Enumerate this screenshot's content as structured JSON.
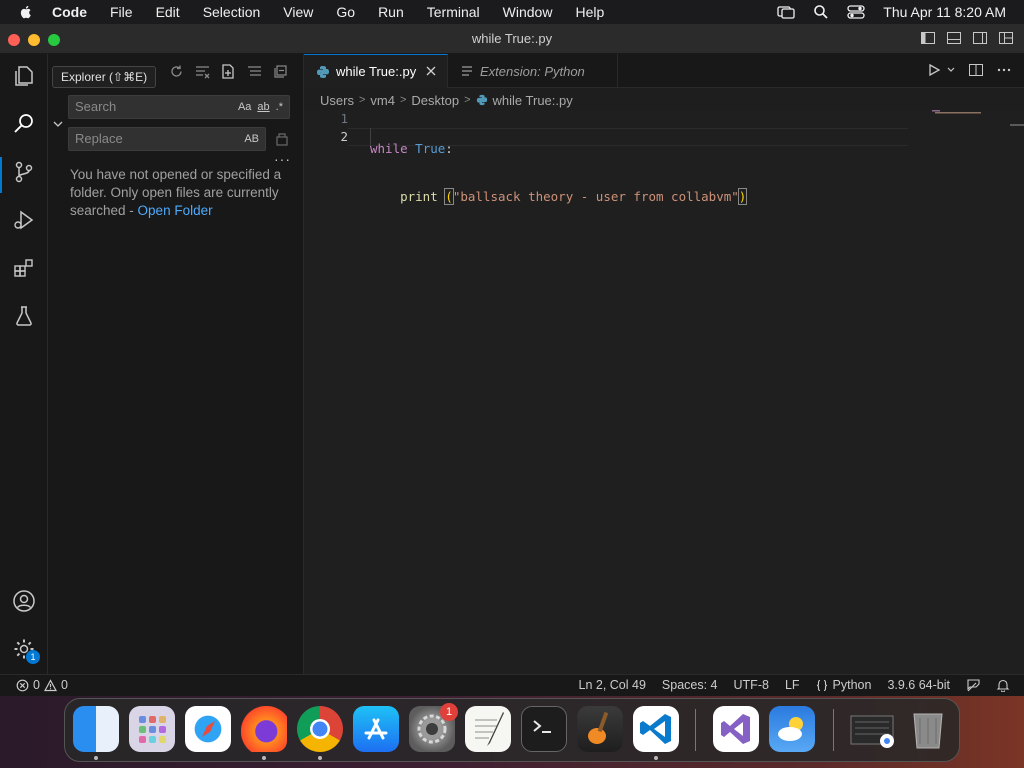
{
  "menubar": {
    "app_name": "Code",
    "items": [
      "File",
      "Edit",
      "Selection",
      "View",
      "Go",
      "Run",
      "Terminal",
      "Window",
      "Help"
    ],
    "clock": "Thu Apr 11  8:20 AM"
  },
  "window": {
    "title": "while True:.py"
  },
  "tooltip": {
    "text": "Explorer (⇧⌘E)"
  },
  "search": {
    "search_placeholder": "Search",
    "replace_placeholder": "Replace",
    "opt_case": "Aa",
    "opt_word": "ab",
    "opt_regex": ".*",
    "opt_preserve_case": "AB",
    "more": "···",
    "info_text": "You have not opened or specified a folder. Only open files are currently searched - ",
    "open_folder_link": "Open Folder"
  },
  "tabs": [
    {
      "label": "while True:.py",
      "active": true
    },
    {
      "label": "Extension: Python",
      "active": false
    }
  ],
  "breadcrumb": [
    "Users",
    "vm4",
    "Desktop",
    "while True:.py"
  ],
  "editor": {
    "line_numbers": [
      "1",
      "2"
    ],
    "line1_keyword": "while",
    "line1_const": "True",
    "line1_colon": ":",
    "line2_indent": "    ",
    "line2_fn": "print",
    "line2_space": " ",
    "line2_open": "(",
    "line2_string": "\"ballsack theory - user from collabvm\"",
    "line2_close": ")"
  },
  "activity_badge": "1",
  "status": {
    "errors": "0",
    "warnings": "0",
    "position": "Ln 2, Col 49",
    "spaces": "Spaces: 4",
    "encoding": "UTF-8",
    "eol": "LF",
    "language": "Python",
    "interpreter": "3.9.6 64-bit"
  },
  "dock": {
    "apps": [
      "finder",
      "launchpad",
      "safari",
      "firefox",
      "chrome",
      "app-store",
      "system-settings",
      "textedit",
      "terminal",
      "garageband",
      "vscode",
      "visual-studio",
      "weather",
      "downloads",
      "trash"
    ],
    "settings_badge": "1"
  },
  "colors": {
    "accent": "#0078d4",
    "link": "#4daafc",
    "keyword": "#c586c0",
    "string": "#ce9178",
    "function": "#dcdcaa"
  }
}
